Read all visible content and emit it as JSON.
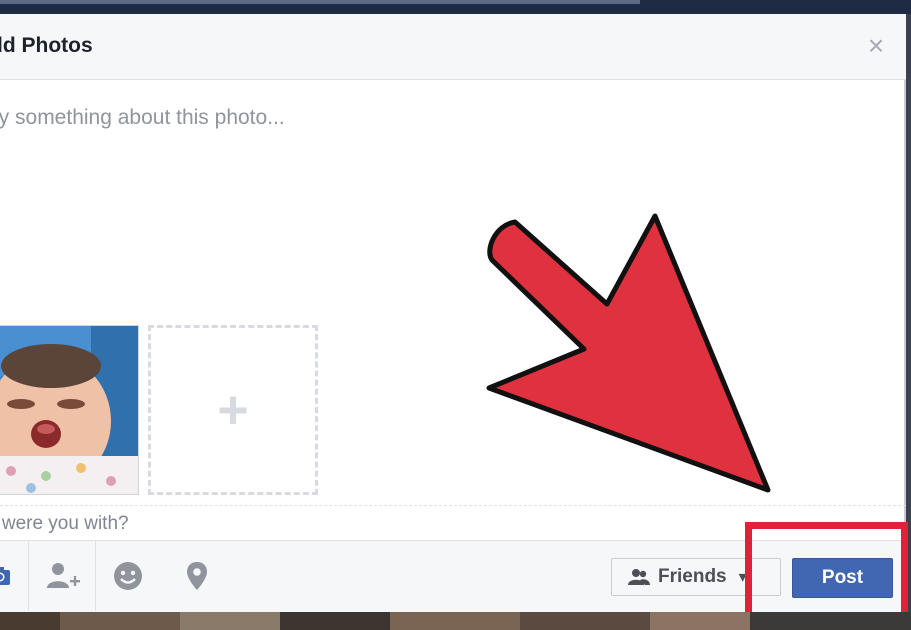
{
  "dialog": {
    "title": "dd Photos",
    "close_label": "×",
    "composer_placeholder": "ay something about this photo...",
    "with_prompt": "o were you with?"
  },
  "attachments": {
    "add_label": "+"
  },
  "footer": {
    "icons": [
      "camera-icon",
      "tag-friends-icon",
      "feeling-icon",
      "location-icon"
    ],
    "audience_label": "Friends",
    "audience_caret": "▾",
    "post_label": "Post"
  },
  "colors": {
    "accent": "#4267b2",
    "highlight": "#e0213a",
    "arrow": "#e0313f"
  }
}
